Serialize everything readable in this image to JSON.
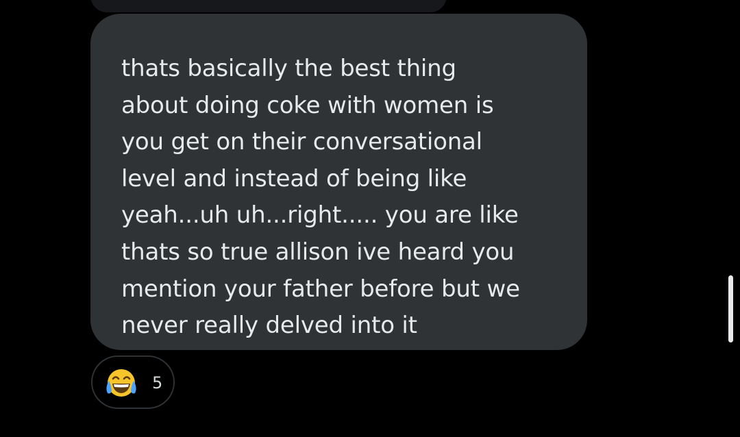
{
  "message": {
    "lines": [
      "thats basically the best thing",
      "about doing coke with women is",
      "you get on their conversational",
      "level and instead of being like",
      "yeah...uh uh...right..... you are like",
      "thats so true allison ive heard you",
      "mention your father before but we",
      "never really delved into it"
    ]
  },
  "reaction": {
    "emoji": "face-with-tears-of-joy-icon",
    "count": "5"
  },
  "colors": {
    "background": "#000000",
    "bubble": "#2f3336",
    "text": "#e7e9ea",
    "emoji_face": "#f7c52b",
    "emoji_tears": "#4aa3ff"
  }
}
